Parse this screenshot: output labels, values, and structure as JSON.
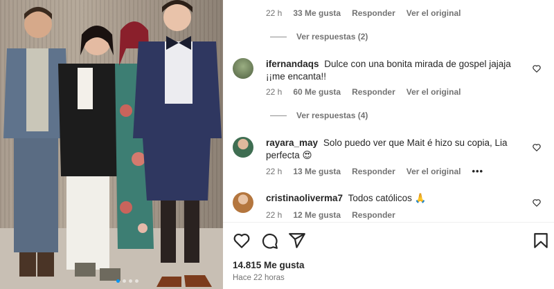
{
  "post": {
    "carousel": {
      "slide_count": 4,
      "active_index": 0
    },
    "likes": "14.815 Me gusta",
    "posted": "Hace 22 horas"
  },
  "top_comment_meta": {
    "time": "22 h",
    "likes": "33 Me gusta",
    "reply": "Responder",
    "see_original": "Ver el original",
    "view_replies": "Ver respuestas (2)"
  },
  "comments": [
    {
      "user": "ifernandaqs",
      "text": "Dulce con una bonita mirada de gospel jajaja ¡¡me encanta!!",
      "time": "22 h",
      "likes": "60 Me gusta",
      "reply": "Responder",
      "see_original": "Ver el original",
      "view_replies": "Ver respuestas (4)",
      "avatar_color": "#6b7d5a"
    },
    {
      "user": "rayara_may",
      "text": "Solo puedo ver que Mait é hizo su copia, Lia perfecta 😍",
      "time": "22 h",
      "likes": "13 Me gusta",
      "reply": "Responder",
      "see_original": "Ver el original",
      "more": "•••",
      "avatar_color": "#4f7a5c"
    },
    {
      "user": "cristinaoliverma7",
      "text": "Todos católicos 🙏",
      "time": "22 h",
      "likes": "12 Me gusta",
      "reply": "Responder",
      "avatar_color": "#b07a4a"
    }
  ],
  "colors": {
    "text": "#262626",
    "secondary": "#737373",
    "accent": "#0095f6"
  },
  "icons": [
    "heart-icon",
    "comment-icon",
    "share-icon",
    "bookmark-icon",
    "more-icon"
  ]
}
